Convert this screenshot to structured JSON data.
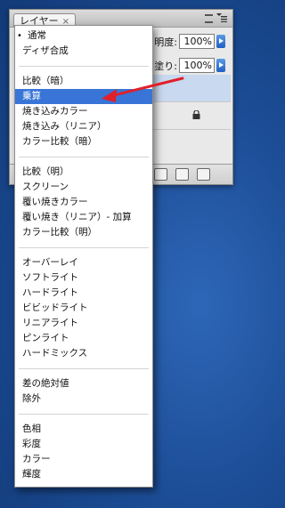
{
  "panel": {
    "tab_label": "レイヤー",
    "tab_close": "×",
    "opacity_label": "明度:",
    "opacity_value": "100%",
    "fill_label": "塗り:",
    "fill_value": "100%"
  },
  "menu": {
    "items": [
      "通常",
      "ディザ合成",
      "比較（暗）",
      "乗算",
      "焼き込みカラー",
      "焼き込み（リニア）",
      "カラー比較（暗）",
      "比較（明）",
      "スクリーン",
      "覆い焼きカラー",
      "覆い焼き（リニア）- 加算",
      "カラー比較（明）",
      "オーバーレイ",
      "ソフトライト",
      "ハードライト",
      "ビビッドライト",
      "リニアライト",
      "ピンライト",
      "ハードミックス",
      "差の絶対値",
      "除外",
      "色相",
      "彩度",
      "カラー",
      "輝度"
    ],
    "checked_item": "通常",
    "highlighted_item": "乗算"
  },
  "colors": {
    "highlight": "#3875d7",
    "arrow": "#e0202a",
    "desktop": "#1c4d96"
  }
}
